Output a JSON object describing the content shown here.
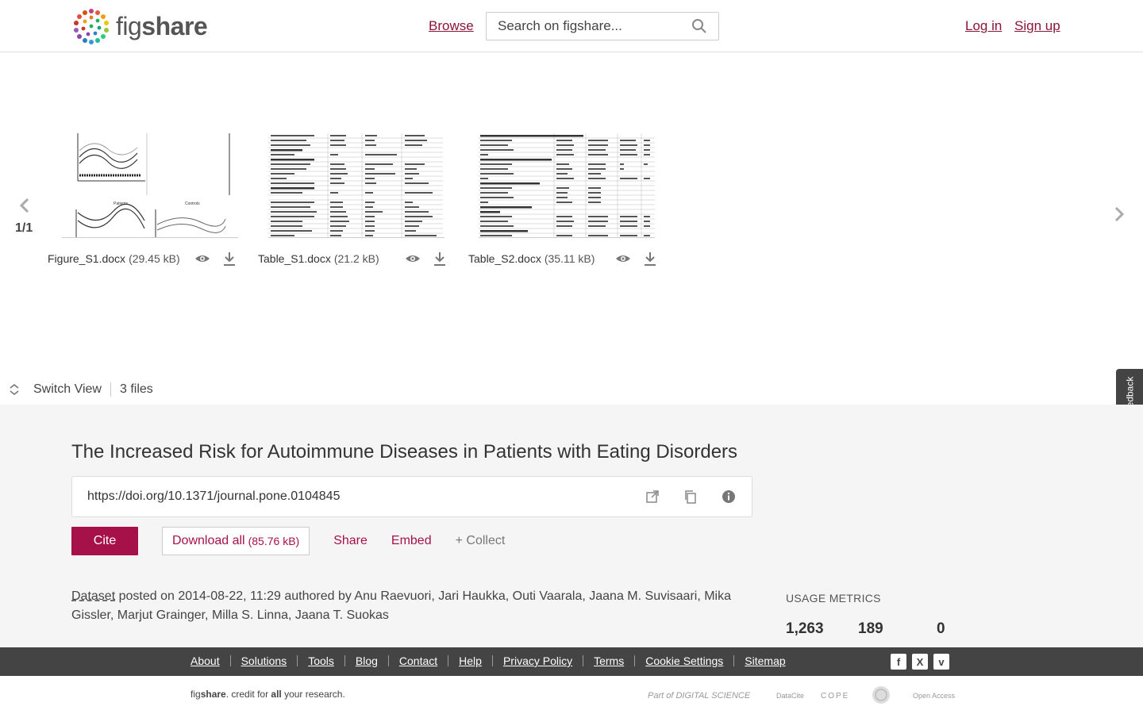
{
  "header": {
    "logo_text_light": "fig",
    "logo_text_bold": "share",
    "browse_label": "Browse",
    "search_placeholder": "Search on figshare...",
    "login_label": "Log in",
    "signup_label": "Sign up"
  },
  "carousel": {
    "page_indicator": "1/1",
    "files": [
      {
        "name": "Figure_S1.docx",
        "size": "(29.45 kB)"
      },
      {
        "name": "Table_S1.docx",
        "size": "(21.2 kB)"
      },
      {
        "name": "Table_S2.docx",
        "size": "(35.11 kB)"
      }
    ],
    "switch_view_label": "Switch View",
    "file_count": "3 files",
    "feedback_label": "Give Feedback"
  },
  "item": {
    "title": "The Increased Risk for Autoimmune Diseases in Patients with Eating Disorders",
    "doi": "https://doi.org/10.1371/journal.pone.0104845",
    "cite_label": "Cite",
    "download_all_label": "Download all",
    "download_all_size": "(85.76 kB)",
    "share_label": "Share",
    "embed_label": "Embed",
    "collect_label": "+ Collect",
    "item_type": "Dataset",
    "posted_text": " posted on 2014-08-22, 11:29 authored by Anu Raevuori, Jari Haukka, Outi Vaarala, Jaana M. Suvisaari, Mika Gissler, Marjut Grainger, Milla S. Linna, Jaana T. Suokas"
  },
  "metrics": {
    "label": "USAGE METRICS",
    "values": [
      "1,263",
      "189",
      "0"
    ]
  },
  "footer": {
    "links": [
      "About",
      "Solutions",
      "Tools",
      "Blog",
      "Contact",
      "Help",
      "Privacy Policy",
      "Terms",
      "Cookie Settings",
      "Sitemap"
    ],
    "tagline_a": "fig",
    "tagline_b": "share",
    "tagline_c": ". credit for ",
    "tagline_d": "all",
    "tagline_e": " your research.",
    "partners": [
      "Part of DIGITAL SCIENCE",
      "DataCite",
      "COPE",
      "Open Access"
    ]
  },
  "colors": {
    "accent": "#a7114a",
    "footer_bg": "#444444",
    "main_bg": "#f5f5f5"
  }
}
